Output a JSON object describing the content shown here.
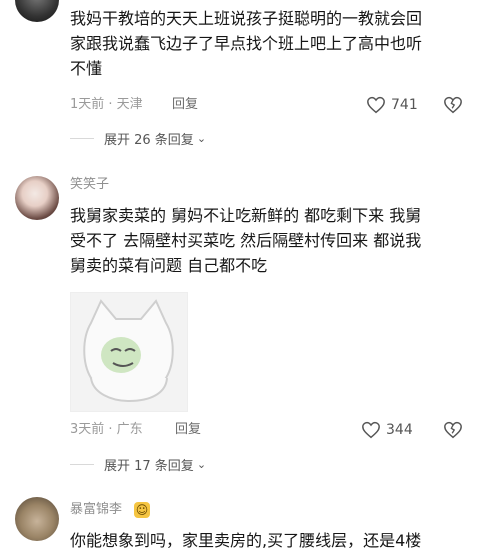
{
  "comments": [
    {
      "username": "",
      "text_lines": [
        "我妈干教培的天天上班说孩子挺聪明的一教就会回",
        "家跟我说蠢飞边子了早点找个班上吧上了高中也听",
        "不懂"
      ],
      "meta": "1天前 · 天津",
      "reply_label": "回复",
      "likes": "741",
      "expand_label": "展开 26 条回复"
    },
    {
      "username": "笑笑子",
      "text_lines": [
        "我舅家卖菜的 舅妈不让吃新鲜的 都吃剩下来 我舅",
        "受不了 去隔壁村买菜吃 然后隔壁村传回来 都说我",
        "舅卖的菜有问题 自己都不吃"
      ],
      "meta": "3天前 · 广东",
      "reply_label": "回复",
      "likes": "344",
      "expand_label": "展开 17 条回复"
    },
    {
      "username": "暴富锦李",
      "text_lines": [
        "你能想象到吗，家里卖房的,买了腰线层，还是4楼"
      ]
    }
  ],
  "icons": {
    "like": "heart-outline-icon",
    "dislike": "broken-heart-icon",
    "expand": "chevron-down-icon",
    "badge": "emoji-cat-icon"
  },
  "colors": {
    "meta": "#9a9a9a",
    "text": "#161616"
  }
}
